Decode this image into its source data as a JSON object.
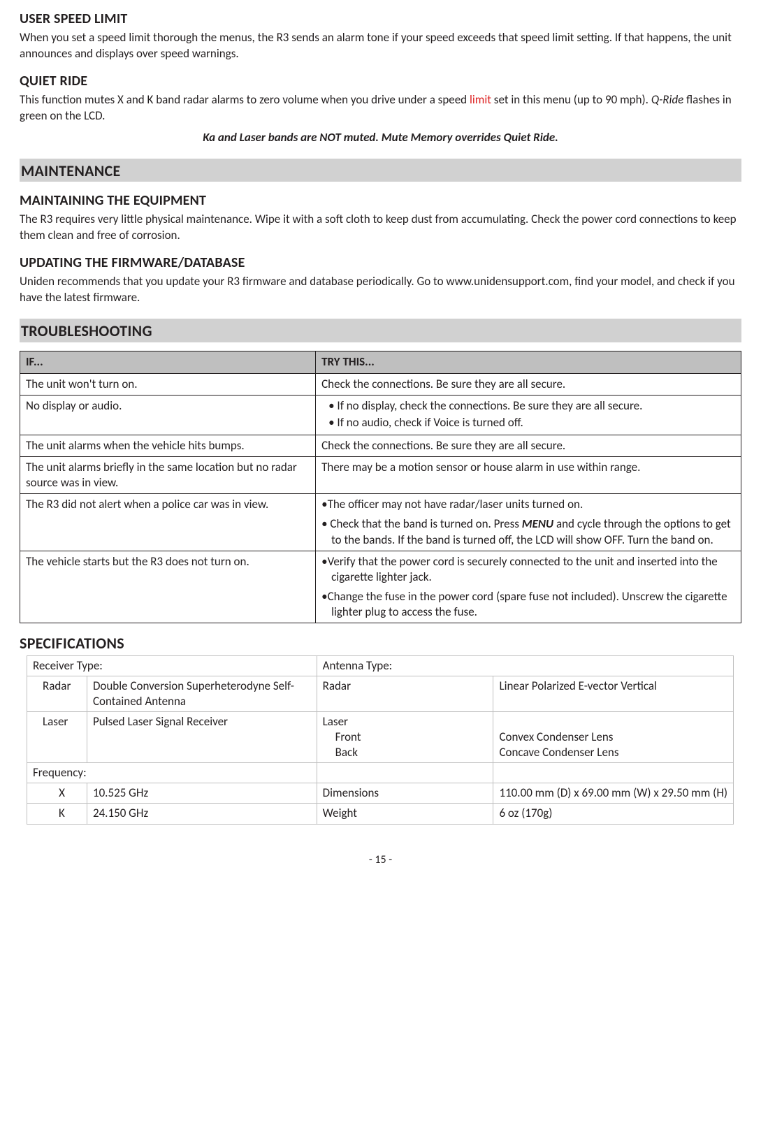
{
  "sections": {
    "user_speed_limit": {
      "heading": "USER SPEED LIMIT",
      "body": "When you set a speed limit thorough the menus, the R3 sends an alarm tone if your speed exceeds that speed limit setting. If that happens, the unit announces and displays over speed warnings."
    },
    "quiet_ride": {
      "heading": "QUIET RIDE",
      "body_pre": "This function mutes X and K band radar alarms to zero volume when you drive under a speed ",
      "body_red": "limit",
      "body_post1": " set in this menu (up to 90 mph). ",
      "body_italic": "Q-Ride",
      "body_post2": " flashes in green on the LCD.",
      "note": "Ka and Laser bands are NOT muted. Mute Memory overrides Quiet Ride."
    },
    "maintenance": {
      "band": "MAINTENANCE",
      "equip_heading": "MAINTAINING THE EQUIPMENT",
      "equip_body": "The R3 requires very little physical maintenance. Wipe it with a soft cloth to keep dust from accumulating. Check the power cord connections to keep them clean and free of corrosion.",
      "firmware_heading": "UPDATING THE FIRMWARE/DATABASE",
      "firmware_body": "Uniden recommends that you update your R3 firmware and database periodically. Go to www.unidensupport.com, find your model, and check if you have the latest firmware."
    },
    "troubleshooting": {
      "band": "TROUBLESHOOTING",
      "headers": {
        "if": "IF...",
        "try": "TRY THIS..."
      },
      "rows": {
        "r0": {
          "if": "The unit won't turn on.",
          "try": "Check the connections. Be sure they are all secure."
        },
        "r1": {
          "if": "No display or audio.",
          "try_li1": "If no display, check the connections. Be sure they are all secure.",
          "try_li2": "If no audio, check if Voice is turned off."
        },
        "r2": {
          "if": "The unit alarms when the vehicle hits bumps.",
          "try": "Check the connections. Be sure they are all secure."
        },
        "r3": {
          "if": "The unit alarms briefly in the same location but no radar source was in view.",
          "try": "There may be a motion sensor or house alarm in use within range."
        },
        "r4": {
          "if": "The R3 did not alert when a police car was in view.",
          "try_li1": "The officer may not have radar/laser units turned on.",
          "try_li2_pre": "Check that the band is turned on. Press ",
          "try_li2_menu": "MENU",
          "try_li2_post": " and cycle through the options to get to the bands. If the band is turned off, the LCD will show OFF. Turn the band on."
        },
        "r5": {
          "if": "The vehicle starts but the R3 does not turn on.",
          "try_li1": "Verify that the power cord is securely connected to the unit and inserted into the cigarette lighter jack.",
          "try_li2": "Change the fuse in the power cord (spare fuse not included). Unscrew the cigarette lighter plug to access the fuse."
        }
      }
    },
    "specifications": {
      "heading": "SPECIFICATIONS",
      "receiver_label": "Receiver Type:",
      "antenna_label": "Antenna Type:",
      "radar_label": "Radar",
      "radar_receiver": "Double Conversion Superheterodyne Self-Contained Antenna",
      "radar_antenna": "Linear Polarized E-vector Vertical",
      "laser_label": "Laser",
      "laser_receiver": "Pulsed Laser Signal Receiver",
      "laser_ant_label": "Laser",
      "laser_front": "Front",
      "laser_back": "Back",
      "laser_front_val": "Convex Condenser Lens",
      "laser_back_val": "Concave Condenser Lens",
      "freq_label": "Frequency:",
      "x_label": "X",
      "x_val": "10.525 GHz",
      "dim_label": "Dimensions",
      "dim_val": "110.00 mm (D) x 69.00 mm (W) x 29.50 mm (H)",
      "k_label": "K",
      "k_val": "24.150 GHz",
      "weight_label": "Weight",
      "weight_val": "6 oz (170g)"
    }
  },
  "page_number": "- 15 -"
}
